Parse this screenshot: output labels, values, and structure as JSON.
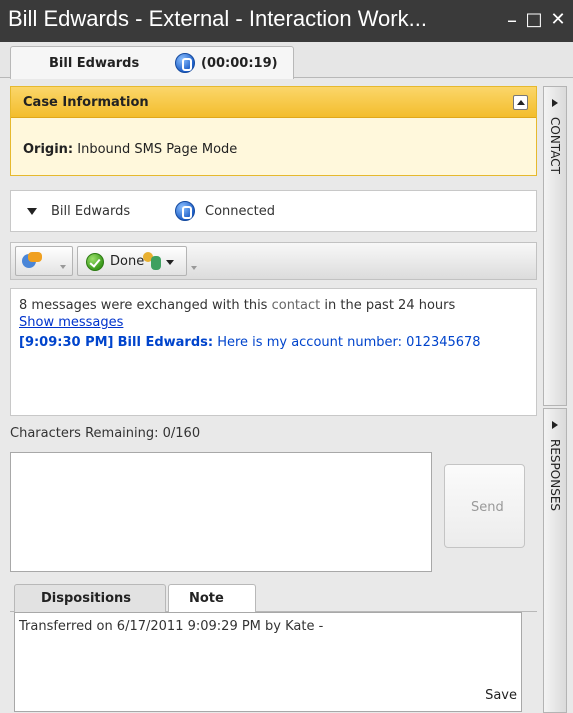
{
  "window": {
    "title": "Bill Edwards - External - Interaction Work...",
    "minimize_glyph": "–",
    "maximize_glyph": "□",
    "close_glyph": "✕"
  },
  "interaction_tab": {
    "name": "Bill Edwards",
    "timer": "(00:00:19)",
    "icon": "chat-status-icon"
  },
  "case_info": {
    "header": "Case Information",
    "origin_label": "Origin:",
    "origin_value": "Inbound SMS Page Mode"
  },
  "party": {
    "name": "Bill Edwards",
    "status": "Connected"
  },
  "toolbar": {
    "done_label": "Done"
  },
  "transcript": {
    "info_before": "8 messages were exchanged with this ",
    "info_highlight": "contact",
    "info_after": " in the past 24 hours",
    "show_messages": "Show messages",
    "msg_time": "[9:09:30 PM]",
    "msg_sender": "Bill Edwards:",
    "msg_text": "Here is my account number: 012345678"
  },
  "composer": {
    "characters_remaining": "Characters Remaining: 0/160",
    "send_label": "Send"
  },
  "bottom_tabs": {
    "dispositions": "Dispositions",
    "note": "Note"
  },
  "note": {
    "text": "Transferred on 6/17/2011 9:09:29 PM by Kate -",
    "save_label": "Save"
  },
  "side_tabs": {
    "contact": "CONTACT",
    "responses": "RESPONSES"
  },
  "colors": {
    "titlebar": "#3a3a3a",
    "case_header": "#f3bd2c",
    "link": "#0033cc",
    "message": "#0044cc"
  }
}
